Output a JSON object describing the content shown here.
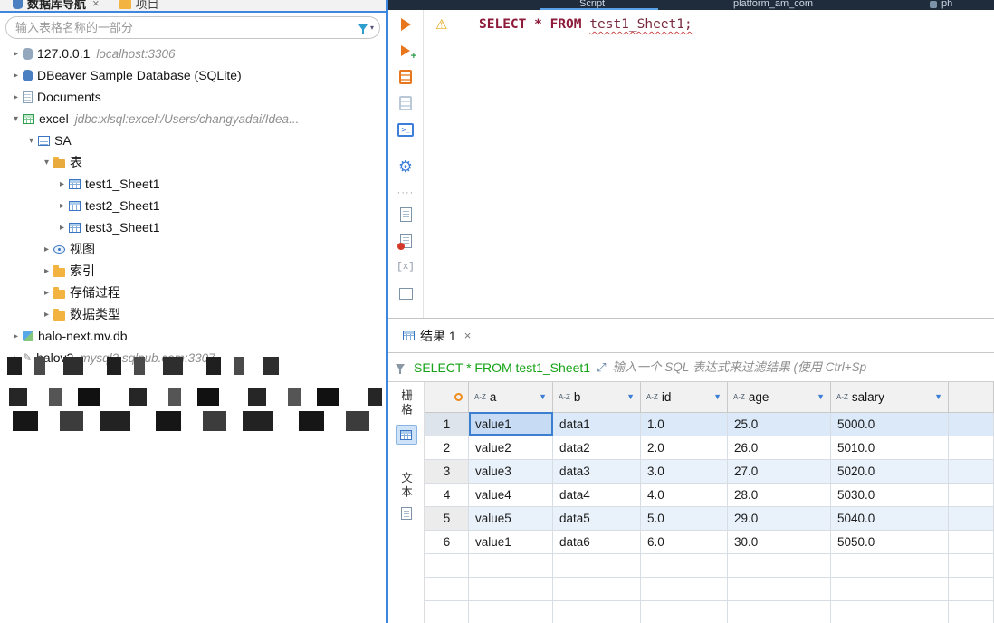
{
  "icons": {
    "dropdown": "▼",
    "chevron_collapsed": "▸",
    "chevron_expanded": "▾",
    "warning": "⚠",
    "gear": "⚙",
    "close": "×",
    "expand": "⤢",
    "pencil": "✎",
    "dots": "····",
    "terminal": ">_",
    "brackets": "[x]",
    "plus": "+"
  },
  "left_tabs": {
    "tab1": "数据库导航",
    "tab1_close": "×",
    "tab2": "项目"
  },
  "navigator": {
    "filter_placeholder": "输入表格名称的一部分",
    "tree": {
      "n1": {
        "label": "127.0.0.1",
        "detail": "localhost:3306"
      },
      "n2": {
        "label": "DBeaver Sample Database (SQLite)"
      },
      "n3": {
        "label": "Documents"
      },
      "n4": {
        "label": "excel",
        "detail": "jdbc:xlsql:excel:/Users/changyadai/Idea..."
      },
      "n5": {
        "label": "SA"
      },
      "n6": {
        "label": "表"
      },
      "n7": {
        "label": "test1_Sheet1"
      },
      "n8": {
        "label": "test2_Sheet1"
      },
      "n9": {
        "label": "test3_Sheet1"
      },
      "n10": {
        "label": "视图"
      },
      "n11": {
        "label": "索引"
      },
      "n12": {
        "label": "存储过程"
      },
      "n13": {
        "label": "数据类型"
      },
      "n14": {
        "label": "halo-next.mv.db"
      },
      "n15": {
        "label": "halov2",
        "detail": "mysql2.sqlpub.com:3307"
      }
    }
  },
  "top_bar": {
    "frag1": "Script",
    "frag2": "platform_am_com",
    "frag3": "ph"
  },
  "sql_editor": {
    "keyword_select": "SELECT",
    "star": "*",
    "keyword_from": "FROM",
    "table_ref": "test1_Sheet1;"
  },
  "results": {
    "tab_label": "结果 1",
    "filter_query": "SELECT * FROM test1_Sheet1",
    "filter_placeholder": "输入一个 SQL 表达式来过滤结果 (使用 Ctrl+Sp",
    "side_tabs": {
      "grid": "栅格",
      "text": "文本"
    },
    "sort_badge": "A-Z",
    "columns": {
      "c1": "a",
      "c2": "b",
      "c3": "id",
      "c4": "age",
      "c5": "salary"
    },
    "rows": [
      [
        "1",
        "value1",
        "data1",
        "1.0",
        "25.0",
        "5000.0"
      ],
      [
        "2",
        "value2",
        "data2",
        "2.0",
        "26.0",
        "5010.0"
      ],
      [
        "3",
        "value3",
        "data3",
        "3.0",
        "27.0",
        "5020.0"
      ],
      [
        "4",
        "value4",
        "data4",
        "4.0",
        "28.0",
        "5030.0"
      ],
      [
        "5",
        "value5",
        "data5",
        "5.0",
        "29.0",
        "5040.0"
      ],
      [
        "6",
        "value1",
        "data6",
        "6.0",
        "30.0",
        "5050.0"
      ]
    ]
  }
}
